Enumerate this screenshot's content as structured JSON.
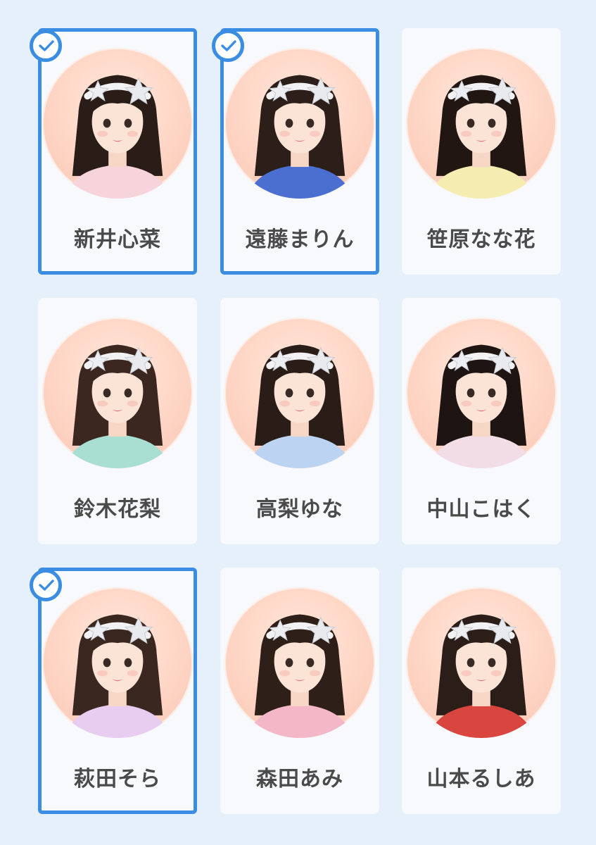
{
  "members": [
    {
      "name": "新井心菜",
      "selected": true,
      "hair": "#2a1c17",
      "accent": "#f7d4dc"
    },
    {
      "name": "遠藤まりん",
      "selected": true,
      "hair": "#2c1e18",
      "accent": "#4a6fd0"
    },
    {
      "name": "笹原なな花",
      "selected": false,
      "hair": "#221613",
      "accent": "#f4ecb0"
    },
    {
      "name": "鈴木花梨",
      "selected": false,
      "hair": "#3b2720",
      "accent": "#a9dfd2"
    },
    {
      "name": "高梨ゆな",
      "selected": false,
      "hair": "#2a1c17",
      "accent": "#bcd3f2"
    },
    {
      "name": "中山こはく",
      "selected": false,
      "hair": "#1e1411",
      "accent": "#f2dce6"
    },
    {
      "name": "萩田そら",
      "selected": true,
      "hair": "#3a2820",
      "accent": "#e8cdf0"
    },
    {
      "name": "森田あみ",
      "selected": false,
      "hair": "#2e1f19",
      "accent": "#f3b7c8"
    },
    {
      "name": "山本るしあ",
      "selected": false,
      "hair": "#2b1d18",
      "accent": "#d9453f"
    }
  ],
  "colors": {
    "selection": "#3a8de3",
    "background": "#e6f0fb",
    "card": "#f7f9fc",
    "text": "#4a4a4a"
  },
  "icons": {
    "check": "check-icon"
  }
}
